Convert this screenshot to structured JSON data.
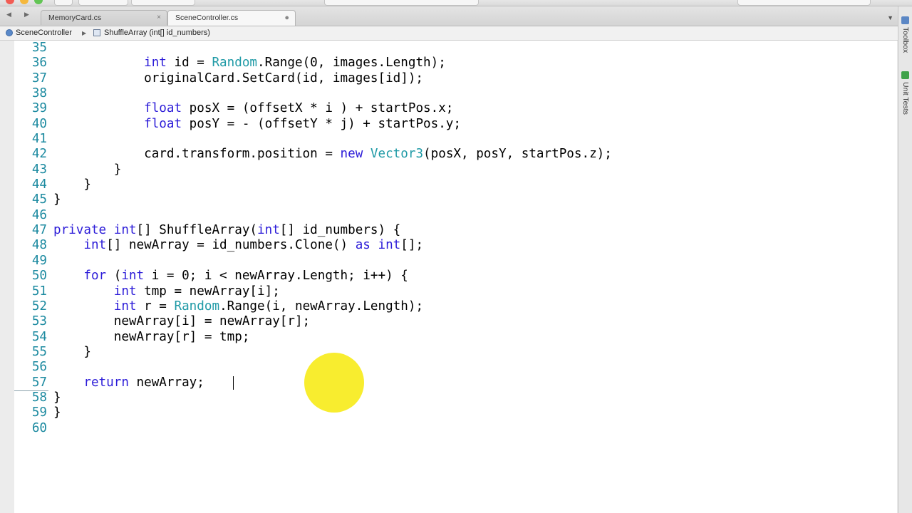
{
  "tabs": [
    {
      "label": "MemoryCard.cs",
      "active": false
    },
    {
      "label": "SceneController.cs",
      "active": true
    }
  ],
  "breadcrumb": {
    "class_name": "SceneController",
    "method_name": "ShuffleArray (int[] id_numbers)"
  },
  "side_panel": {
    "toolbox_label": "Toolbox",
    "unit_tests_label": "Unit Tests"
  },
  "colors": {
    "keyword": "#2c1cd8",
    "type": "#1f9aa6",
    "line_number": "#1c8aa0",
    "highlight_circle": "#f7ec1d"
  },
  "editor": {
    "current_line": 57,
    "lines": [
      {
        "num": "35"
      },
      {
        "num": "36"
      },
      {
        "num": "37"
      },
      {
        "num": "38"
      },
      {
        "num": "39"
      },
      {
        "num": "40"
      },
      {
        "num": "41"
      },
      {
        "num": "42"
      },
      {
        "num": "43"
      },
      {
        "num": "44"
      },
      {
        "num": "45"
      },
      {
        "num": "46"
      },
      {
        "num": "47"
      },
      {
        "num": "48"
      },
      {
        "num": "49"
      },
      {
        "num": "50"
      },
      {
        "num": "51"
      },
      {
        "num": "52"
      },
      {
        "num": "53"
      },
      {
        "num": "54"
      },
      {
        "num": "55"
      },
      {
        "num": "56"
      },
      {
        "num": "57"
      },
      {
        "num": "58"
      },
      {
        "num": "59"
      },
      {
        "num": "60"
      }
    ],
    "code": {
      "l36": {
        "indent": "            ",
        "t1": "int",
        "p1": " id = ",
        "t2": "Random",
        "p2": ".Range(0, images.Length);"
      },
      "l37": {
        "indent": "            ",
        "p1": "originalCard.SetCard(id, images[id]);"
      },
      "l39": {
        "indent": "            ",
        "t1": "float",
        "p1": " posX = (offsetX * i ) + startPos.x;"
      },
      "l40": {
        "indent": "            ",
        "t1": "float",
        "p1": " posY = - (offsetY * j) + startPos.y;"
      },
      "l42": {
        "indent": "            ",
        "p1": "card.transform.position = ",
        "t1": "new",
        "p2": " ",
        "t2": "Vector3",
        "p3": "(posX, posY, startPos.z);"
      },
      "l43": {
        "indent": "        ",
        "p1": "}"
      },
      "l44": {
        "indent": "    ",
        "p1": "}"
      },
      "l45": {
        "indent": "",
        "p1": "}"
      },
      "l47": {
        "indent": "",
        "t1": "private",
        "p1": " ",
        "t2": "int",
        "p2": "[] ShuffleArray(",
        "t3": "int",
        "p3": "[] id_numbers) {"
      },
      "l48": {
        "indent": "    ",
        "t1": "int",
        "p1": "[] newArray = id_numbers.Clone() ",
        "t2": "as",
        "p2": " ",
        "t3": "int",
        "p3": "[];"
      },
      "l50": {
        "indent": "    ",
        "t1": "for",
        "p1": " (",
        "t2": "int",
        "p2": " i = 0; i < newArray.Length; i++) {"
      },
      "l51": {
        "indent": "        ",
        "t1": "int",
        "p1": " tmp = newArray[i];"
      },
      "l52": {
        "indent": "        ",
        "t1": "int",
        "p1": " r = ",
        "t2": "Random",
        "p2": ".Range(i, newArray.Length);"
      },
      "l53": {
        "indent": "        ",
        "p1": "newArray[i] = newArray[r];"
      },
      "l54": {
        "indent": "        ",
        "p1": "newArray[r] = tmp;"
      },
      "l55": {
        "indent": "    ",
        "p1": "}"
      },
      "l57": {
        "indent": "    ",
        "t1": "return",
        "p1": " newArray;"
      },
      "l58": {
        "indent": "",
        "p1": "}"
      },
      "l59": {
        "indent": "",
        "p1": "}"
      }
    }
  }
}
